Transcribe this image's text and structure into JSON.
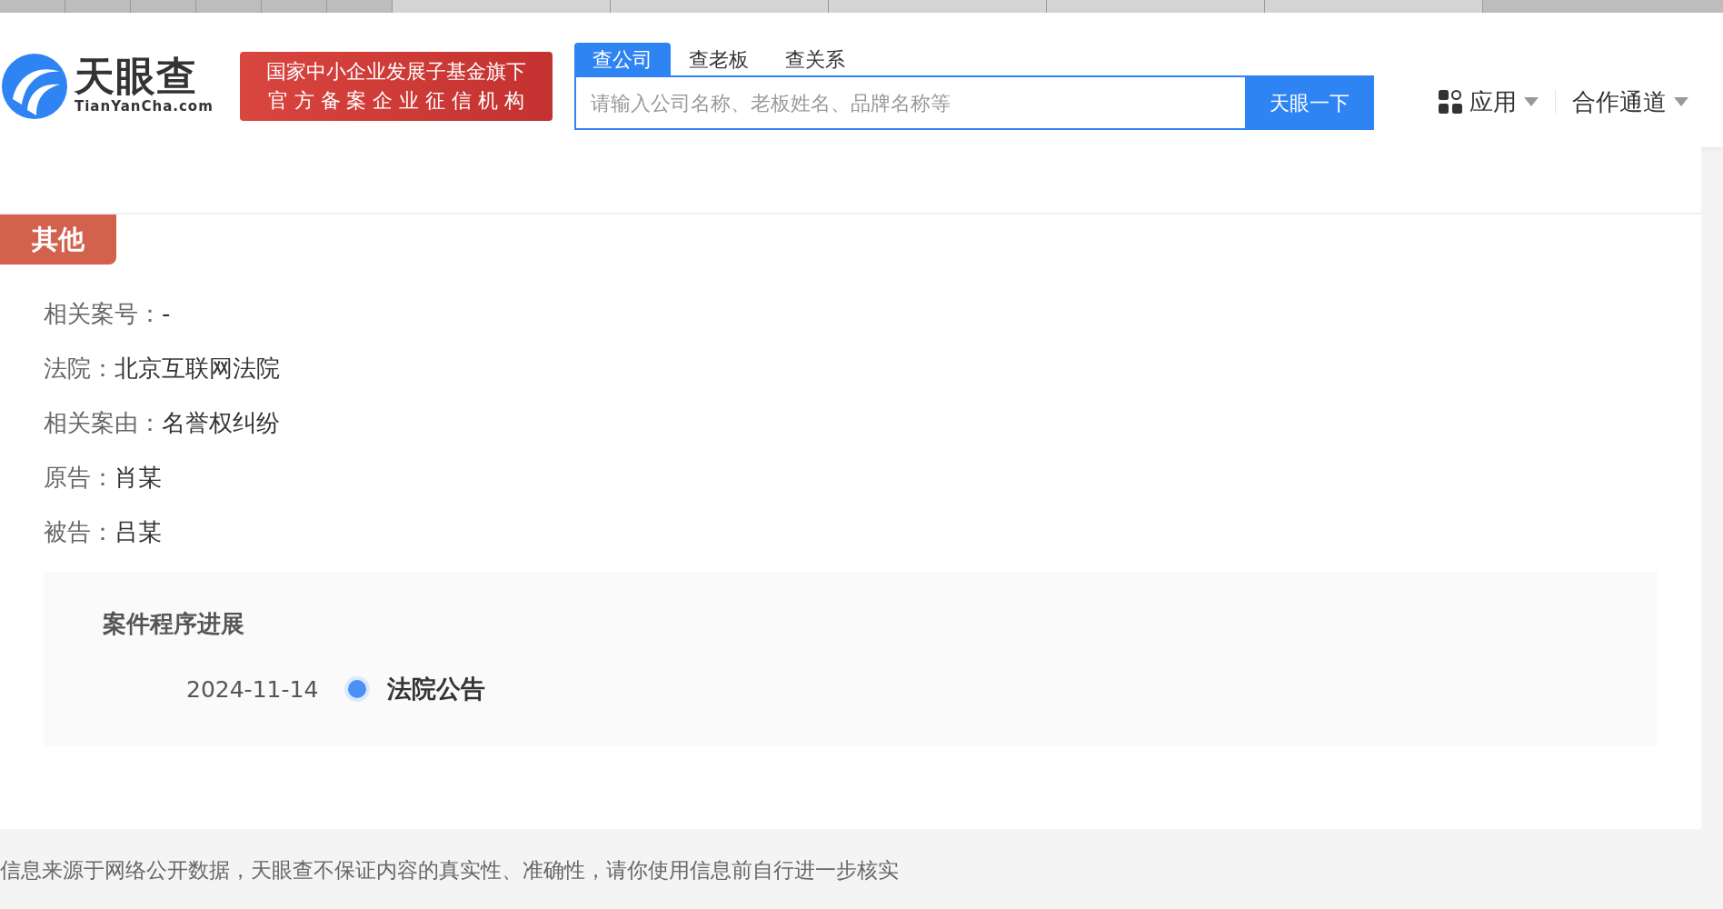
{
  "header": {
    "logo": {
      "name": "天眼查",
      "domain": "TianYanCha.com"
    },
    "badge_lines": [
      "国家中小企业发展子基金旗下",
      "官 方 备 案 企 业 征 信 机 构"
    ],
    "search_tabs": [
      {
        "label": "查公司",
        "selected": true
      },
      {
        "label": "查老板",
        "selected": false
      },
      {
        "label": "查关系",
        "selected": false
      }
    ],
    "search": {
      "placeholder": "请输入公司名称、老板姓名、品牌名称等",
      "button": "天眼一下"
    },
    "nav": [
      {
        "label": "应用",
        "kind": "apps"
      },
      {
        "label": "合作通道",
        "kind": "plain"
      }
    ]
  },
  "section": {
    "tag": "其他",
    "fields": [
      {
        "label": "相关案号：",
        "value": "-"
      },
      {
        "label": "法院：",
        "value": "北京互联网法院"
      },
      {
        "label": "相关案由：",
        "value": "名誉权纠纷"
      },
      {
        "label": "原告：",
        "value": "肖某"
      },
      {
        "label": "被告：",
        "value": "吕某"
      }
    ],
    "progress": {
      "title": "案件程序进展",
      "events": [
        {
          "date": "2024-11-14",
          "title": "法院公告"
        }
      ]
    }
  },
  "footer": "信息来源于网络公开数据，天眼查不保证内容的真实性、准确性，请你使用信息前自行进一步核实"
}
